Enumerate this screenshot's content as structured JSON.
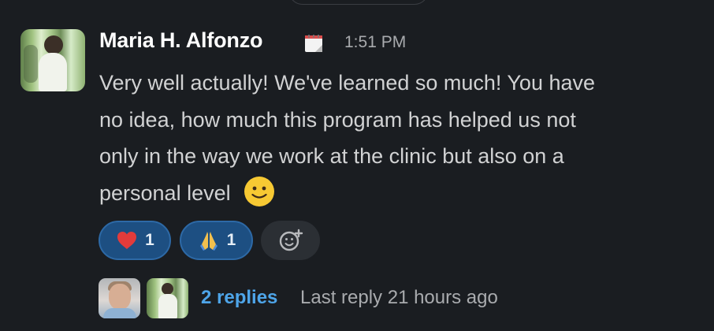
{
  "message": {
    "author": "Maria H. Alfonzo",
    "status_icon": "calendar-icon",
    "time": "1:51 PM",
    "text_lines": [
      "Very well actually! We've learned so much! You have",
      "no idea, how much this program has helped us not",
      "only in the way we work at the clinic but also on a",
      "personal level"
    ],
    "inline_emoji": "slightly-smiling-face-icon"
  },
  "reactions": [
    {
      "emoji": "red-heart-icon",
      "count": "1"
    },
    {
      "emoji": "folded-hands-icon",
      "count": "1"
    }
  ],
  "add_reaction": {
    "icon": "add-emoji-icon"
  },
  "thread": {
    "replies_label": "2 replies",
    "last_reply_label": "Last reply 21 hours ago"
  },
  "colors": {
    "background": "#1a1d21",
    "name": "#ffffff",
    "message_text": "#d1d2d3",
    "muted_text": "#a9abae",
    "reaction_bg": "#1d4f82",
    "reaction_border": "#2d69a6",
    "link": "#4ea5e9"
  }
}
